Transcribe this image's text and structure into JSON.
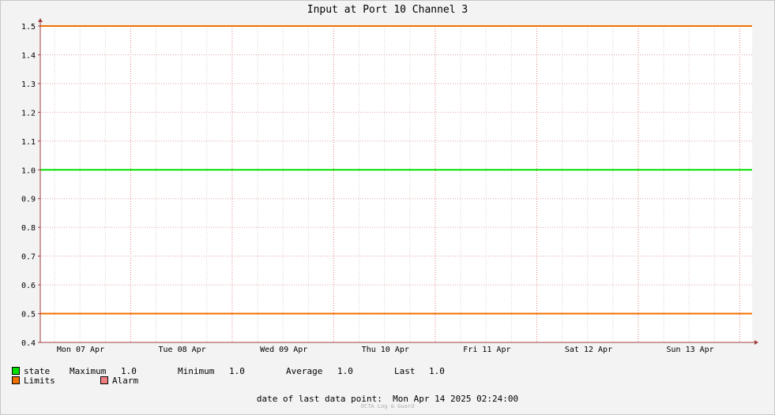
{
  "chart_data": {
    "type": "line",
    "title": "Input at Port 10 Channel 3",
    "x_ticks": [
      "Mon 07 Apr",
      "Tue 08 Apr",
      "Wed 09 Apr",
      "Thu 10 Apr",
      "Fri 11 Apr",
      "Sat 12 Apr",
      "Sun 13 Apr"
    ],
    "y_ticks": [
      "0.4",
      "0.5",
      "0.6",
      "0.7",
      "0.8",
      "0.9",
      "1.0",
      "1.1",
      "1.2",
      "1.3",
      "1.4",
      "1.5"
    ],
    "ylim": [
      0.4,
      1.5
    ],
    "grid": true,
    "series": [
      {
        "name": "state",
        "color": "#00e000",
        "values": [
          1.0,
          1.0,
          1.0,
          1.0,
          1.0,
          1.0,
          1.0,
          1.0
        ]
      },
      {
        "name": "Limits",
        "color": "#f07000",
        "values": [
          1.5,
          1.5,
          1.5,
          1.5,
          1.5,
          1.5,
          1.5,
          1.5
        ]
      },
      {
        "name": "Limits",
        "color": "#f07000",
        "values": [
          0.5,
          0.5,
          0.5,
          0.5,
          0.5,
          0.5,
          0.5,
          0.5
        ]
      }
    ]
  },
  "legend": {
    "state_label": "state",
    "maximum_label": "Maximum",
    "maximum_value": "1.0",
    "minimum_label": "Minimum",
    "minimum_value": "1.0",
    "average_label": "Average",
    "average_value": "1.0",
    "last_label": "Last",
    "last_value": "1.0",
    "limits_label": "Limits",
    "alarm_label": "Alarm",
    "state_color": "#00e000",
    "limits_color": "#f07000",
    "alarm_color": "#f08080"
  },
  "footer": {
    "last_point_label": "date of last data point:",
    "last_point_value": "Mon Apr 14 2025 02:24:00",
    "watermark": "OCTA Log & Guard"
  }
}
